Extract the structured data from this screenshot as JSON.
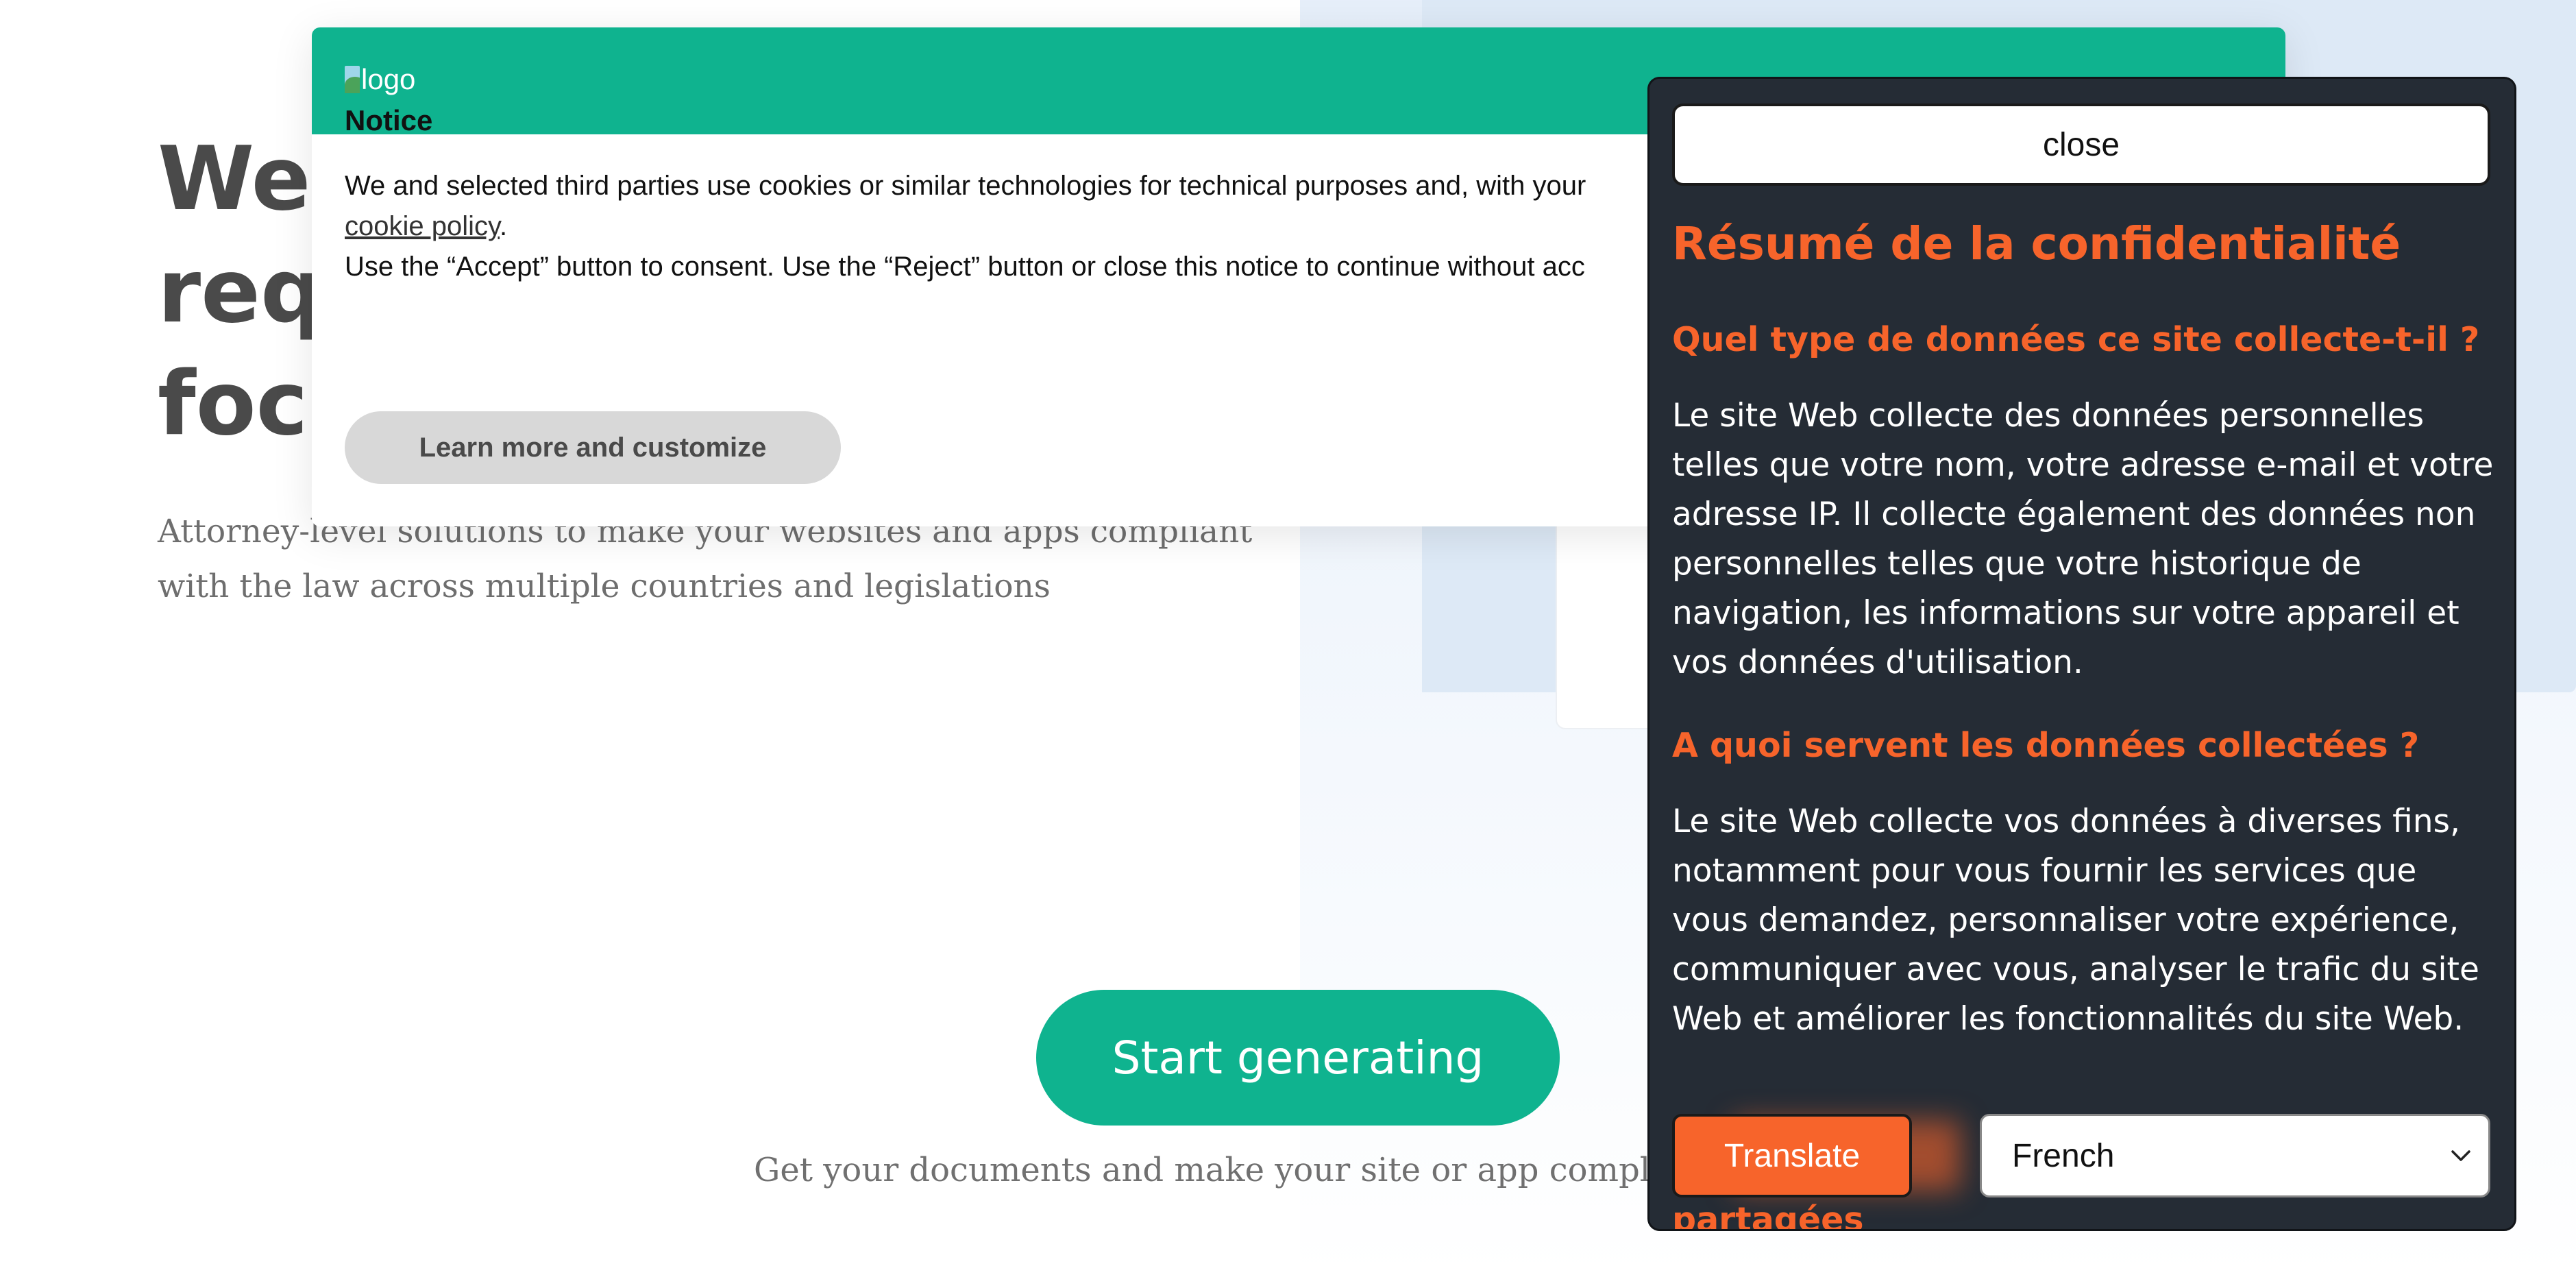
{
  "hero": {
    "title_lines": [
      "We",
      "requ",
      "focu"
    ],
    "subtitle": "Attorney-level solutions to make your websites and apps compliant with the law across multiple countries and legislations",
    "cta_label": "Start generating",
    "cta_sub": "Get your documents and make your site or app complian"
  },
  "notice": {
    "logo_alt": "logo",
    "title": "Notice",
    "line1": "We and selected third parties use cookies or similar technologies for technical purposes and, with your",
    "link": "cookie policy",
    "line2_suffix": ".",
    "line3": "Use the “Accept” button to consent. Use the “Reject” button or close this notice to continue without acc",
    "learn_more_label": "Learn more and customize"
  },
  "panel": {
    "close_label": "close",
    "title": "Résumé de la confidentialité",
    "sections": [
      {
        "title": "Quel type de données ce site collecte-t-il ?",
        "text": "Le site Web collecte des données personnelles telles que votre nom, votre adresse e-mail et votre adresse IP. Il collecte également des données non personnelles telles que votre historique de navigation, les informations sur votre appareil et vos données d'utilisation."
      },
      {
        "title": "A quoi servent les données collectées ?",
        "text": "Le site Web collecte vos données à diverses fins, notamment pour vous fournir les services que vous demandez, personnaliser votre expérience, communiquer avec vous, analyser le trafic du site Web et améliorer les fonctionnalités du site Web."
      }
    ],
    "cut_title": "partagées",
    "translate_label": "Translate",
    "language_selected": "French",
    "accent_color": "#f7642b",
    "background_color": "#252c35"
  },
  "colors": {
    "brand_green": "#0fb38f"
  }
}
